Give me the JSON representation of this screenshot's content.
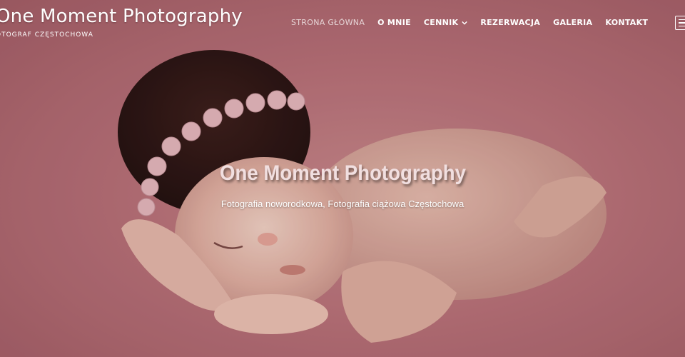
{
  "header": {
    "brand_title": "One Moment Photography",
    "brand_subtitle": "OTOGRAF CZĘSTOCHOWA"
  },
  "nav": {
    "items": [
      {
        "label": "STRONA GŁÓWNA",
        "active": true
      },
      {
        "label": "O MNIE"
      },
      {
        "label": "CENNIK",
        "has_dropdown": true
      },
      {
        "label": "REZERWACJA"
      },
      {
        "label": "GALERIA"
      },
      {
        "label": "KONTAKT"
      }
    ],
    "menu_icon": "hamburger-menu-icon",
    "dropdown_icon": "chevron-down-icon"
  },
  "hero": {
    "title": "One Moment Photography",
    "subtitle": "Fotografia noworodkowa, Fotografia ciążowa Częstochowa",
    "image": "newborn-baby-photo",
    "background_color": "#b9737a",
    "title_color": "#f1dfe0"
  }
}
